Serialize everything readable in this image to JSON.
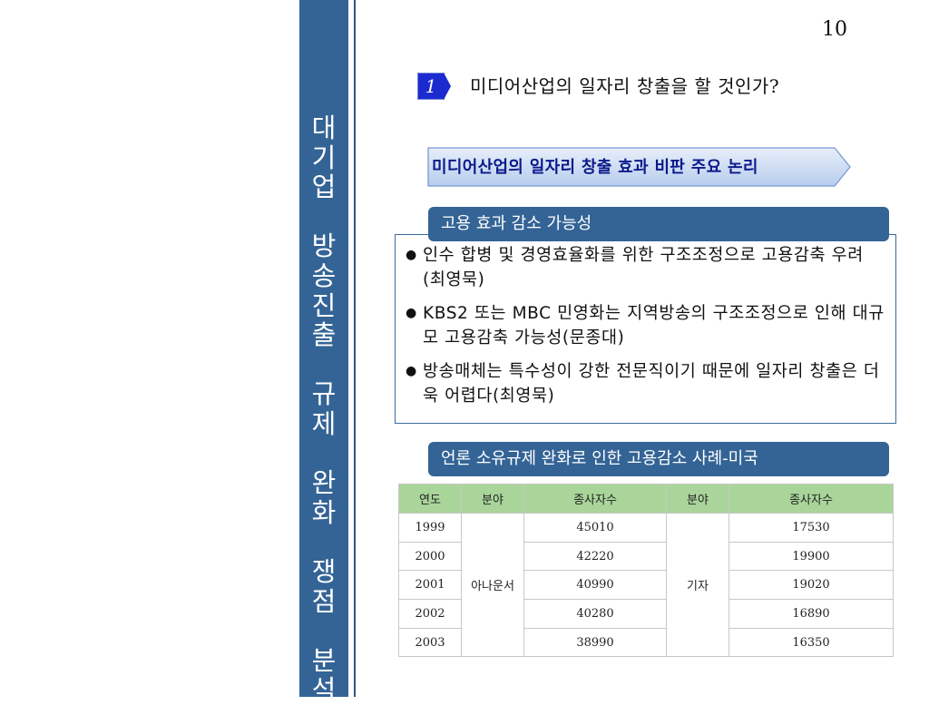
{
  "page_number": "10",
  "sidebar": {
    "title_lines": [
      "대",
      "기",
      "업",
      "",
      "방",
      "송",
      "진",
      "출",
      "",
      "규",
      "제",
      "",
      "완",
      "화",
      "",
      "쟁",
      "점",
      "",
      "분",
      "석"
    ]
  },
  "section": {
    "number": "1",
    "heading": "미디어산업의 일자리 창출을 할 것인가?"
  },
  "arrow_label": "미디어산업의 일자리 창출 효과  비판 주요 논리",
  "box1": {
    "header": "고용 효과 감소 가능성",
    "bullets": [
      "인수 합병 및 경영효율화를 위한 구조조정으로 고용감축 우려(최영묵)",
      "KBS2 또는 MBC 민영화는 지역방송의 구조조정으로 인해 대규모 고용감축 가능성(문종대)",
      "방송매체는 특수성이 강한 전문직이기 때문에 일자리 창출은 더욱 어렵다(최영묵)"
    ]
  },
  "box2": {
    "header": "언론 소유규제 완화로 인한 고용감소 사례-미국"
  },
  "table": {
    "headers": [
      "연도",
      "분야",
      "종사자수",
      "분야",
      "종사자수"
    ],
    "field1": "아나운서",
    "field2": "기자",
    "rows": [
      {
        "year": "1999",
        "count1": "45010",
        "count2": "17530"
      },
      {
        "year": "2000",
        "count1": "42220",
        "count2": "19900"
      },
      {
        "year": "2001",
        "count1": "40990",
        "count2": "19020"
      },
      {
        "year": "2002",
        "count1": "40280",
        "count2": "16890"
      },
      {
        "year": "2003",
        "count1": "38990",
        "count2": "16350"
      }
    ]
  },
  "colors": {
    "sidebar": "#346496",
    "badge": "#1b2bd0",
    "table_header": "#a9d59a",
    "arrow_text": "#0c1a8a"
  }
}
